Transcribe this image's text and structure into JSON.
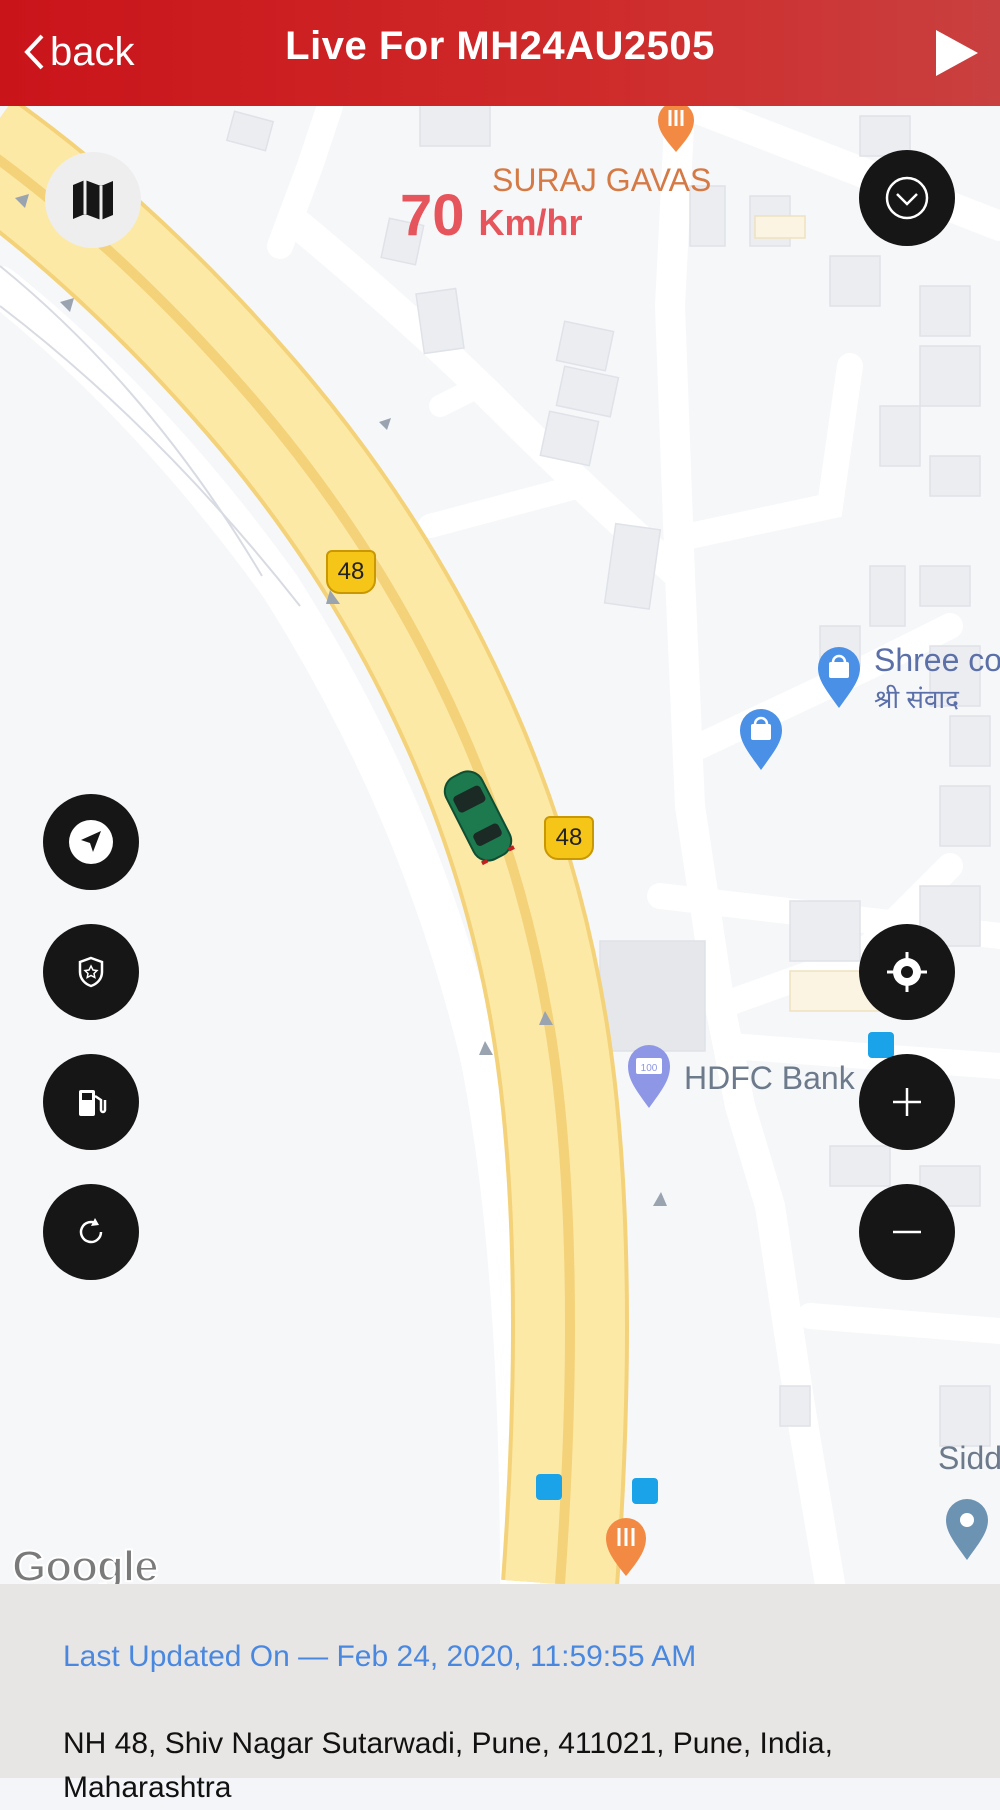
{
  "header": {
    "back_label": "back",
    "title": "Live For MH24AU2505"
  },
  "map": {
    "speed_value": "70",
    "speed_unit": "Km/hr",
    "pois": {
      "suraj": "SURAJ GAVAS",
      "shree": "Shree co",
      "shree_hi": "श्री संवाद",
      "hdfc": "HDFC Bank",
      "sidd": "Sidd"
    },
    "shield_label": "48",
    "attribution": "Google"
  },
  "panel": {
    "last_updated": "Last Updated On — Feb 24, 2020, 11:59:55 AM",
    "address": "NH 48, Shiv Nagar Sutarwadi, Pune, 411021, Pune, India, Maharashtra"
  },
  "colors": {
    "header": "#c9141a",
    "highway": "#fde9a6",
    "highway_edge": "#f3d27a",
    "fab": "#161616",
    "link_blue": "#4a88e0",
    "speed_red": "#e5555b"
  }
}
